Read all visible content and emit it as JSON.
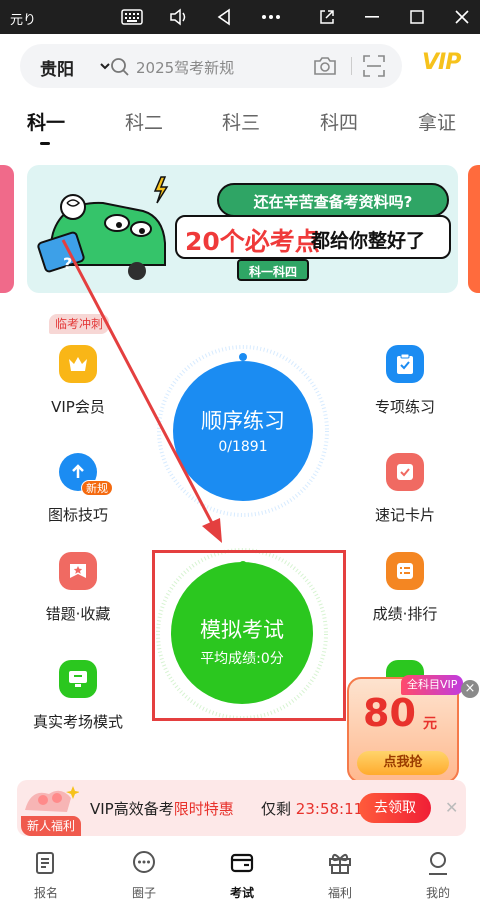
{
  "window": {
    "title": "元り"
  },
  "header": {
    "city": "贵阳",
    "search_placeholder": "2025驾考新规",
    "vip_logo": "VIP"
  },
  "tabs": [
    {
      "label": "科一",
      "active": true
    },
    {
      "label": "科二",
      "active": false
    },
    {
      "label": "科三",
      "active": false
    },
    {
      "label": "科四",
      "active": false
    },
    {
      "label": "拿证",
      "active": false
    }
  ],
  "banner": {
    "bubble": "还在辛苦查备考资料吗?",
    "highlight": "20个必考点",
    "rest": "都给你整好了",
    "tag": "科一科四"
  },
  "grid": {
    "sprint_badge": "临考冲刺",
    "left": [
      {
        "label": "VIP会员",
        "icon": "crown-icon",
        "color": "#f9b617"
      },
      {
        "label": "图标技巧",
        "icon": "upload-icon",
        "color": "#1b8cf2",
        "badge": "新规"
      },
      {
        "label": "错题·收藏",
        "icon": "star-icon",
        "color": "#f06a62"
      },
      {
        "label": "真实考场模式",
        "icon": "monitor-icon",
        "color": "#2bc71f"
      }
    ],
    "right": [
      {
        "label": "专项练习",
        "icon": "clipboard-icon",
        "color": "#1b8cf2"
      },
      {
        "label": "速记卡片",
        "icon": "card-check-icon",
        "color": "#f06a62"
      },
      {
        "label": "成绩·排行",
        "icon": "list-icon",
        "color": "#f48622"
      }
    ]
  },
  "order_practice": {
    "title": "顺序练习",
    "progress": "0/1891",
    "done": 0,
    "total": 1891
  },
  "mock_exam": {
    "title": "模拟考试",
    "avg_score": "平均成绩:0分"
  },
  "promo": {
    "tag": "全科目VIP",
    "amount": "80",
    "unit": "元",
    "button": "点我抢"
  },
  "vip_bar": {
    "newbie": "新人福利",
    "text_plain": "VIP高效备考",
    "text_highlight": "限时特惠",
    "remain_label": "仅剩",
    "countdown": "23:58:11",
    "button": "去领取"
  },
  "bottom_nav": [
    {
      "label": "报名",
      "icon": "register-icon",
      "active": false
    },
    {
      "label": "圈子",
      "icon": "chat-icon",
      "active": false
    },
    {
      "label": "考试",
      "icon": "exam-icon",
      "active": true
    },
    {
      "label": "福利",
      "icon": "gift-icon",
      "active": false
    },
    {
      "label": "我的",
      "icon": "profile-icon",
      "active": false
    }
  ],
  "colors": {
    "blue": "#1b8cf2",
    "green": "#2bc71f",
    "annotation_red": "#e43f3f",
    "countdown_red": "#e8322c"
  }
}
